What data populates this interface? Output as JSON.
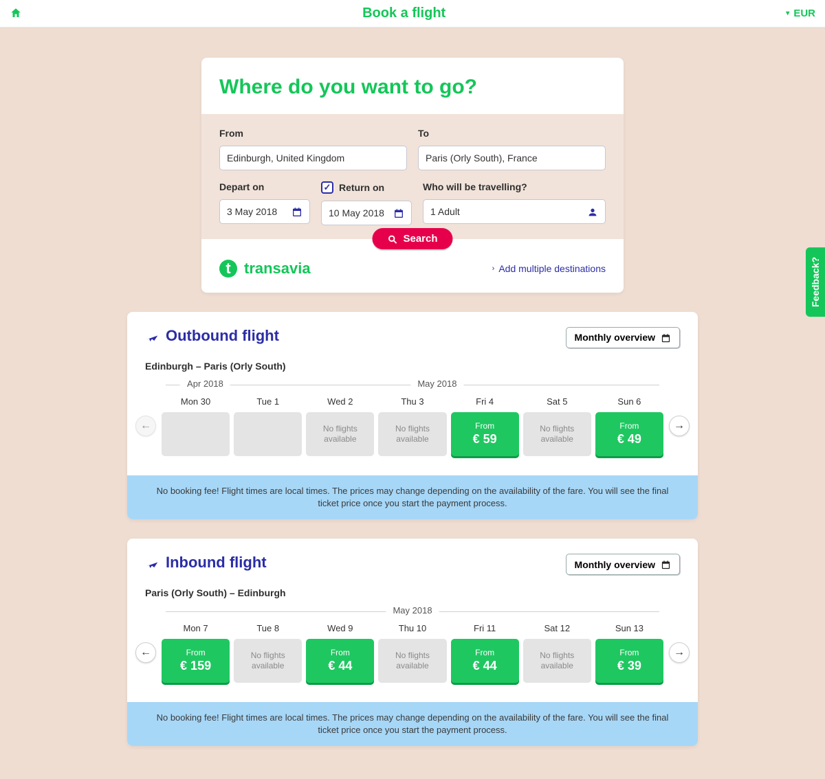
{
  "topbar": {
    "title": "Book a flight",
    "currency": "EUR"
  },
  "search": {
    "heading": "Where do you want to go?",
    "from_label": "From",
    "to_label": "To",
    "depart_label": "Depart on",
    "return_label": "Return on",
    "travellers_label": "Who will be travelling?",
    "from_value": "Edinburgh, United Kingdom",
    "to_value": "Paris (Orly South), France",
    "depart_value": "3 May 2018",
    "return_value": "10 May 2018",
    "travellers_value": "1 Adult",
    "return_checked": true,
    "search_label": "Search",
    "brand": "transavia",
    "add_multi": "Add multiple destinations"
  },
  "feedback": "Feedback?",
  "outbound": {
    "title": "Outbound flight",
    "route": "Edinburgh – Paris (Orly South)",
    "overview_btn": "Monthly overview",
    "months": [
      {
        "label": "Apr 2018",
        "left_pct": 8
      },
      {
        "label": "May 2018",
        "left_pct": 55
      }
    ],
    "prev_enabled": false,
    "next_enabled": true,
    "days": [
      {
        "dow": "Mon 30",
        "type": "empty"
      },
      {
        "dow": "Tue 1",
        "type": "empty"
      },
      {
        "dow": "Wed 2",
        "type": "nofly",
        "text": "No flights available"
      },
      {
        "dow": "Thu 3",
        "type": "nofly",
        "text": "No flights available"
      },
      {
        "dow": "Fri 4",
        "type": "price",
        "from": "From",
        "price": "€ 59"
      },
      {
        "dow": "Sat 5",
        "type": "nofly",
        "text": "No flights available"
      },
      {
        "dow": "Sun 6",
        "type": "price",
        "from": "From",
        "price": "€ 49"
      }
    ],
    "disclaimer": "No booking fee! Flight times are local times. The prices may change depending on the availability of the fare. You will see the final ticket price once you start the payment process."
  },
  "inbound": {
    "title": "Inbound flight",
    "route": "Paris (Orly South) – Edinburgh",
    "overview_btn": "Monthly overview",
    "months": [
      {
        "label": "May 2018",
        "left_pct": 50
      }
    ],
    "prev_enabled": true,
    "next_enabled": true,
    "days": [
      {
        "dow": "Mon 7",
        "type": "price",
        "from": "From",
        "price": "€ 159"
      },
      {
        "dow": "Tue 8",
        "type": "nofly",
        "text": "No flights available"
      },
      {
        "dow": "Wed 9",
        "type": "price",
        "from": "From",
        "price": "€ 44"
      },
      {
        "dow": "Thu 10",
        "type": "nofly",
        "text": "No flights available"
      },
      {
        "dow": "Fri 11",
        "type": "price",
        "from": "From",
        "price": "€ 44"
      },
      {
        "dow": "Sat 12",
        "type": "nofly",
        "text": "No flights available"
      },
      {
        "dow": "Sun 13",
        "type": "price",
        "from": "From",
        "price": "€ 39"
      }
    ],
    "disclaimer": "No booking fee! Flight times are local times. The prices may change depending on the availability of the fare. You will see the final ticket price once you start the payment process."
  }
}
